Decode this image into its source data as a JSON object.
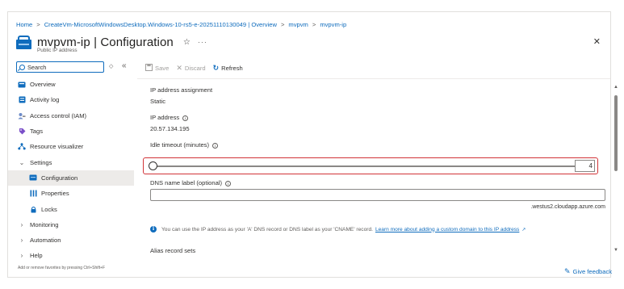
{
  "breadcrumb": {
    "items": [
      "Home",
      "CreateVm-MicrosoftWindowsDesktop.Windows-10-rs5-e-20251110130049 | Overview",
      "mvpvm",
      "mvpvm-ip"
    ],
    "separator": ">"
  },
  "header": {
    "title": "mvpvm-ip | Configuration",
    "subtitle": "Public IP address",
    "favorite_icon": "star-outline-icon",
    "more_icon": "ellipsis-icon",
    "close_icon": "close-icon"
  },
  "sidebar": {
    "search_placeholder": "Search",
    "items": [
      {
        "label": "Overview",
        "icon": "overview-icon"
      },
      {
        "label": "Activity log",
        "icon": "activity-log-icon"
      },
      {
        "label": "Access control (IAM)",
        "icon": "iam-icon"
      },
      {
        "label": "Tags",
        "icon": "tag-icon"
      },
      {
        "label": "Resource visualizer",
        "icon": "visualizer-icon"
      },
      {
        "label": "Settings",
        "icon": "chevron-down-icon"
      },
      {
        "label": "Configuration",
        "icon": "configuration-icon"
      },
      {
        "label": "Properties",
        "icon": "properties-icon"
      },
      {
        "label": "Locks",
        "icon": "lock-icon"
      },
      {
        "label": "Monitoring",
        "icon": "chevron-right-icon"
      },
      {
        "label": "Automation",
        "icon": "chevron-right-icon"
      },
      {
        "label": "Help",
        "icon": "chevron-right-icon"
      }
    ],
    "hint": "Add or remove favorites by pressing Ctrl+Shift+F"
  },
  "toolbar": {
    "save_label": "Save",
    "discard_label": "Discard",
    "refresh_label": "Refresh"
  },
  "form": {
    "assignment_label": "IP address assignment",
    "assignment_value": "Static",
    "ip_label": "IP address",
    "ip_value": "20.57.134.195",
    "idle_label": "Idle timeout (minutes)",
    "idle_value": "4",
    "idle_min": 4,
    "idle_max": 30,
    "dns_label": "DNS name label (optional)",
    "dns_value": "",
    "dns_suffix": ".westus2.cloudapp.azure.com",
    "notice_text": "You can use the IP address as your 'A' DNS record or DNS label as your 'CNAME' record.",
    "notice_link": "Learn more about adding a custom domain to this IP address",
    "alias_label": "Alias record sets"
  },
  "feedback_label": "Give feedback",
  "colors": {
    "accent": "#0f6cbd",
    "highlight": "#d13438"
  }
}
